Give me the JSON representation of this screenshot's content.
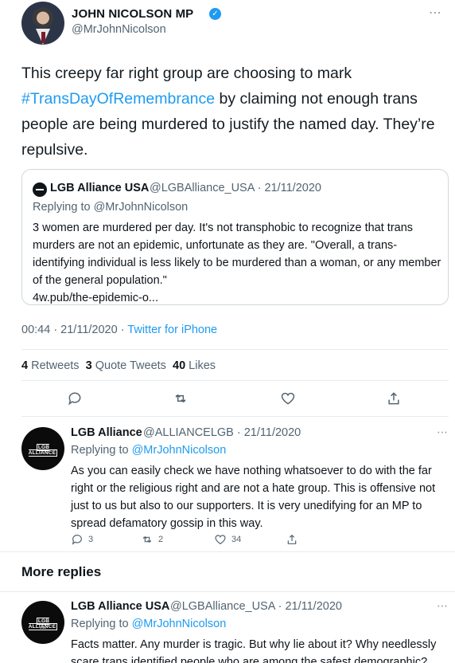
{
  "tweet": {
    "author_name": "JOHN NICOLSON MP",
    "author_handle": "@MrJohnNicolson",
    "more_icon": "⋯",
    "text_before": "This creepy far right group are choosing to mark ",
    "hashtag": "#TransDayOfRemembrance",
    "text_after": " by claiming not enough trans people are being murdered to justify the named day. They’re repulsive.",
    "time": "00:44 · 21/11/2020 · ",
    "source": "Twitter for iPhone",
    "retweets_count": "4",
    "retweets_label": "Retweets",
    "quote_count": "3",
    "quote_label": "Quote Tweets",
    "likes_count": "40",
    "likes_label": "Likes"
  },
  "quote": {
    "name": "LGB Alliance USA",
    "handle_date": "@LGBAlliance_USA · 21/11/2020",
    "replying": "Replying to @MrJohnNicolson",
    "text": "3 women are murdered per day. It's not transphobic to recognize that trans murders are not an epidemic, unfortunate as they are. \"Overall, a trans-identifying individual is less likely to be murdered than a woman, or any member of the general population.\"",
    "link": "4w.pub/the-epidemic-o..."
  },
  "reply1": {
    "avatar_text": "LGB ALLIANCE",
    "name": "LGB Alliance",
    "handle_date": "@ALLIANCELGB · 21/11/2020",
    "replying_prefix": "Replying to ",
    "replying_handle": "@MrJohnNicolson",
    "text": "As you can easily check we have nothing whatsoever to do with the far right or the religious right and are not a hate group. This is offensive not just to us but also to our supporters. It is very unedifying for an MP to spread defamatory gossip in this way.",
    "reply_count": "3",
    "retweet_count": "2",
    "like_count": "34"
  },
  "more_replies_label": "More replies",
  "reply2": {
    "avatar_text": "LGB ALLIANCE",
    "avatar_sub": "USA",
    "name": "LGB Alliance USA",
    "handle_date": "@LGBAlliance_USA · 21/11/2020",
    "replying_prefix": "Replying to ",
    "replying_handle": "@MrJohnNicolson",
    "text": "Facts matter. Any murder is tragic. But why lie about it? Why needlessly scare trans identified people who are among the safest demographic?"
  },
  "colors": {
    "accent": "#1d9bf0",
    "muted": "#536471",
    "border": "#cfd9de"
  }
}
